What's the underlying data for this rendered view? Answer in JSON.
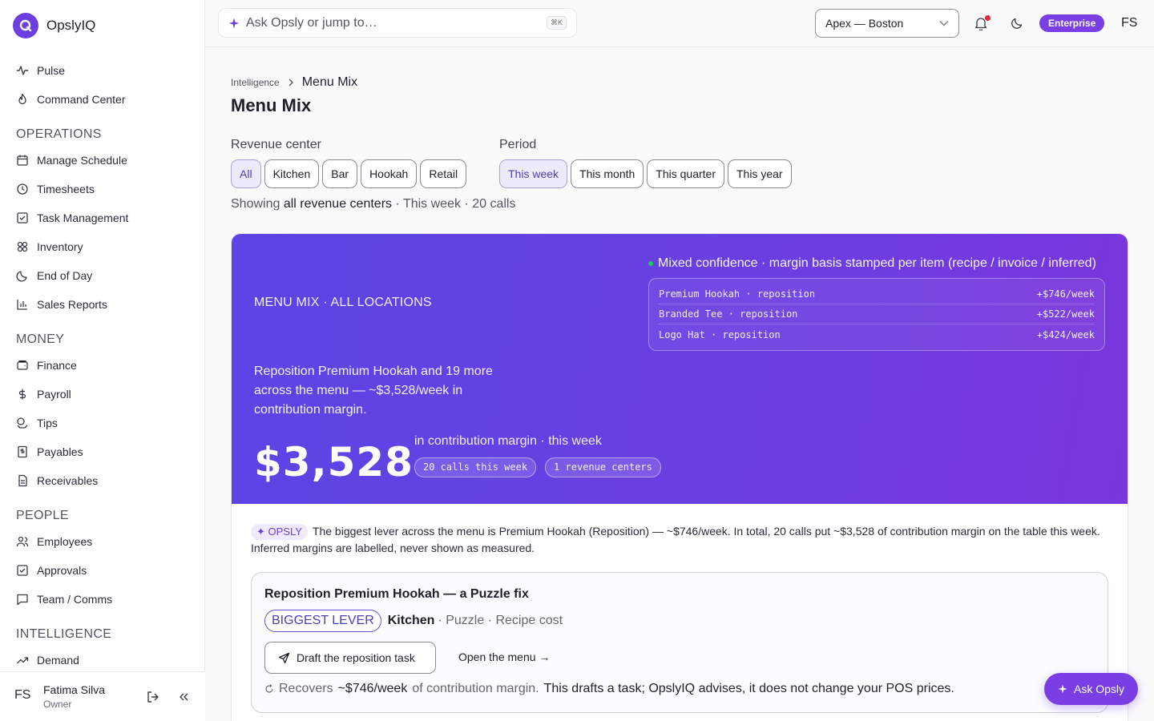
{
  "app": {
    "name": "OpslyIQ"
  },
  "sidebar": {
    "top_items": [
      {
        "label": "Pulse",
        "icon": "pulse-icon"
      },
      {
        "label": "Command Center",
        "icon": "flame-icon"
      }
    ],
    "groups": [
      {
        "title": "OPERATIONS",
        "items": [
          {
            "label": "Manage Schedule",
            "icon": "calendar-icon"
          },
          {
            "label": "Timesheets",
            "icon": "clock-icon"
          },
          {
            "label": "Task Management",
            "icon": "checkbox-icon"
          },
          {
            "label": "Inventory",
            "icon": "boxes-icon"
          },
          {
            "label": "End of Day",
            "icon": "moon-icon"
          },
          {
            "label": "Sales Reports",
            "icon": "bar-chart-icon"
          }
        ]
      },
      {
        "title": "MONEY",
        "items": [
          {
            "label": "Finance",
            "icon": "wallet-icon"
          },
          {
            "label": "Payroll",
            "icon": "dollar-icon"
          },
          {
            "label": "Tips",
            "icon": "coins-icon"
          },
          {
            "label": "Payables",
            "icon": "receipt-icon"
          },
          {
            "label": "Receivables",
            "icon": "document-icon"
          }
        ]
      },
      {
        "title": "PEOPLE",
        "items": [
          {
            "label": "Employees",
            "icon": "users-icon"
          },
          {
            "label": "Approvals",
            "icon": "checkbox-icon"
          },
          {
            "label": "Team / Comms",
            "icon": "message-icon"
          }
        ]
      },
      {
        "title": "INTELLIGENCE",
        "items": [
          {
            "label": "Demand",
            "icon": "trend-up-icon"
          }
        ]
      }
    ],
    "user": {
      "initials": "FS",
      "name": "Fatima Silva",
      "role": "Owner"
    }
  },
  "topbar": {
    "search_placeholder": "Ask Opsly or jump to…",
    "shortcut": "⌘K",
    "location": "Apex — Boston",
    "plan": "Enterprise",
    "initials": "FS"
  },
  "page": {
    "breadcrumb_parent": "Intelligence",
    "breadcrumb_current": "Menu Mix",
    "title": "Menu Mix",
    "revenue_center_label": "Revenue center",
    "revenue_centers": [
      "All",
      "Kitchen",
      "Bar",
      "Hookah",
      "Retail"
    ],
    "revenue_center_selected": "All",
    "period_label": "Period",
    "periods": [
      "This week",
      "This month",
      "This quarter",
      "This year"
    ],
    "period_selected": "This week",
    "showing_prefix": "Showing",
    "showing_scope": "all revenue centers",
    "showing_suffix": "· This week · 20 calls"
  },
  "hero": {
    "eyebrow": "MENU MIX · ALL LOCATIONS",
    "headline": "Reposition Premium Hookah and 19 more across the menu — ~$3,528/week in contribution margin.",
    "amount": "$3,528",
    "amount_caption": "in contribution margin · this week",
    "pills": [
      "20 calls this week",
      "1 revenue centers"
    ],
    "confidence": "Mixed confidence · margin basis stamped per item (recipe / invoice / inferred)",
    "confidence_color": "#18c964",
    "levers": [
      {
        "item": "Premium Hookah · reposition",
        "value": "+$746/week"
      },
      {
        "item": "Branded Tee · reposition",
        "value": "+$522/week"
      },
      {
        "item": "Logo Hat · reposition",
        "value": "+$424/week"
      }
    ]
  },
  "opsly": {
    "tag": "OPSLY",
    "summary": "The biggest lever across the menu is Premium Hookah (Reposition) — ~$746/week. In total, 20 calls put ~$3,528 of contribution margin on the table this week. Inferred margins are labelled, never shown as measured."
  },
  "recommendation": {
    "title": "Reposition Premium Hookah — a Puzzle fix",
    "badge": "BIGGEST LEVER",
    "center": "Kitchen",
    "meta": "· Puzzle · Recipe cost",
    "primary_action": "Draft the reposition task",
    "secondary_action": "Open the menu →",
    "recovers_prefix": "Recovers",
    "recovers_value": "~$746/week",
    "recovers_mid": "of contribution margin.",
    "recovers_note": "This drafts a task; OpslyIQ advises, it does not change your POS prices."
  },
  "fab": {
    "label": "Ask Opsly"
  },
  "colors": {
    "accent": "#7a3fe4",
    "hero_start": "#5b45e4",
    "hero_end": "#7a35dc"
  }
}
